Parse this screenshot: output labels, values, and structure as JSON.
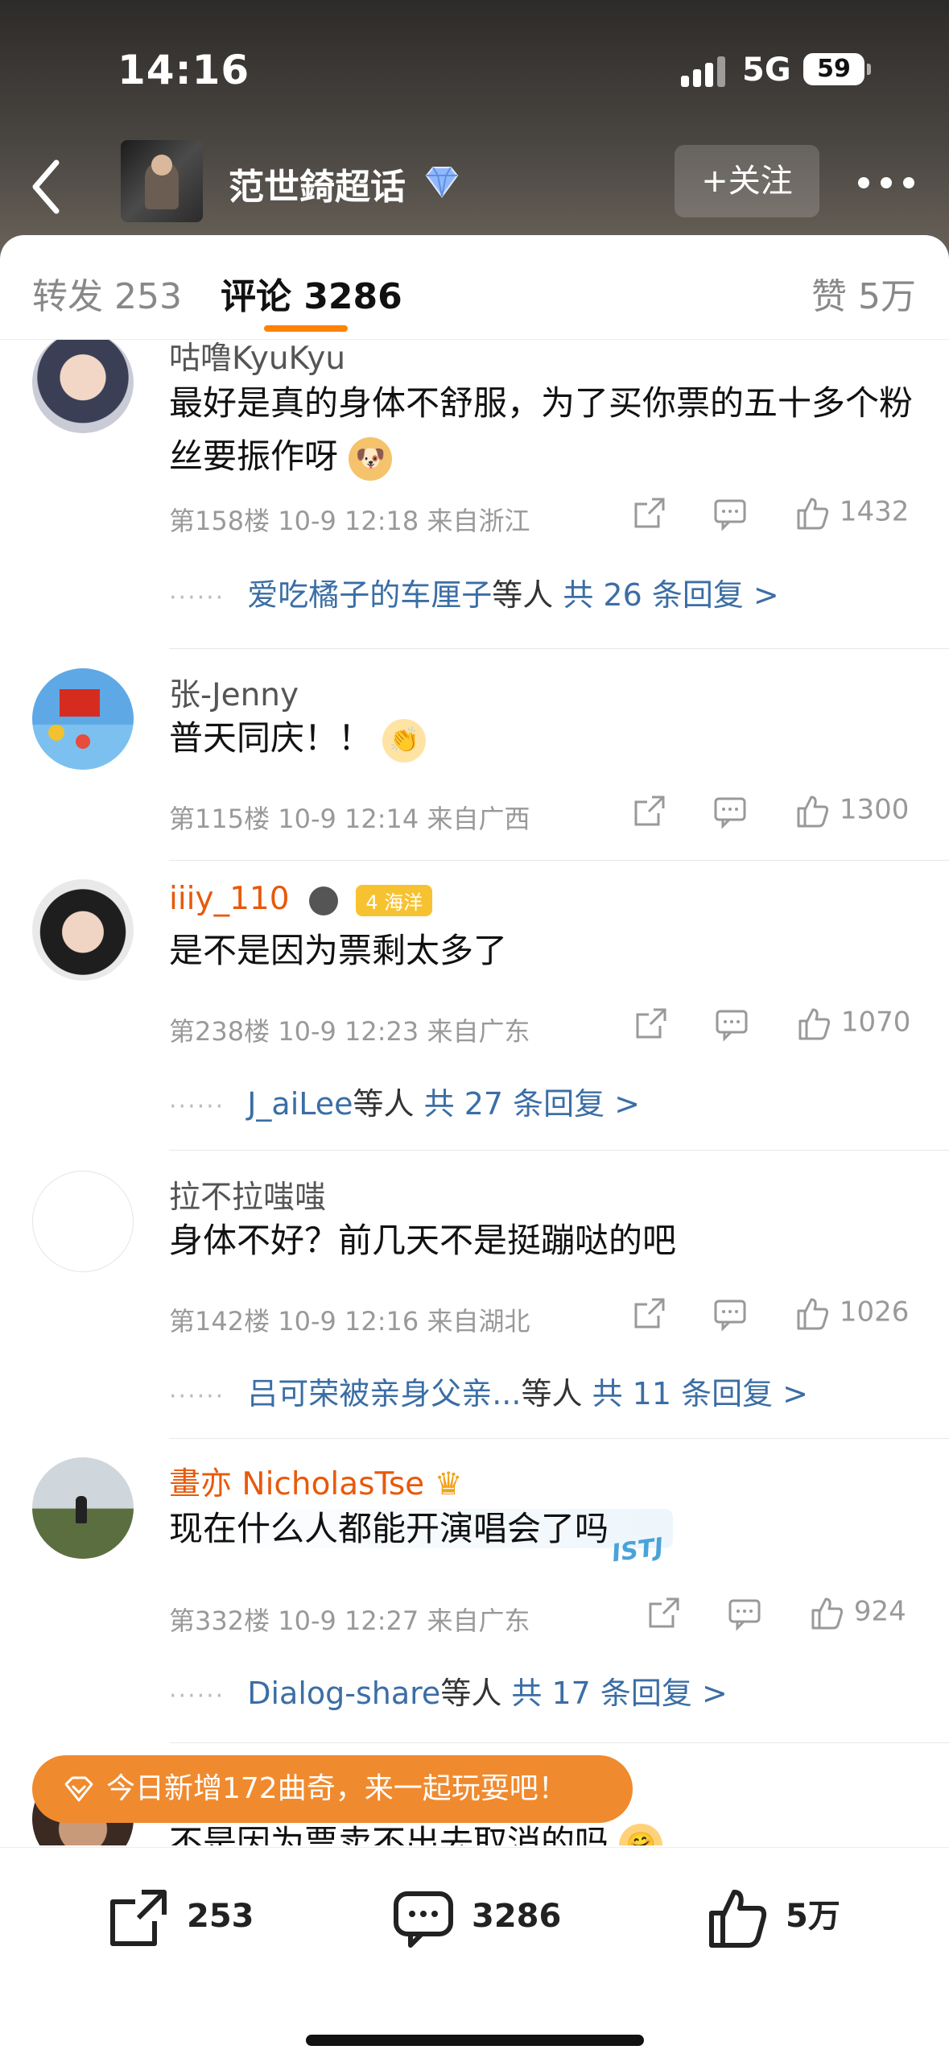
{
  "status_bar": {
    "time": "14:16",
    "network": "5G",
    "battery": "59"
  },
  "header": {
    "title": "范世錡超话",
    "follow_label": "+关注"
  },
  "tabs": {
    "repost": "转发 253",
    "comments": "评论 3286",
    "likes": "赞 5万"
  },
  "comments": [
    {
      "username": "咕噜KyuKyu",
      "text": "最好是真的身体不舒服，为了买你票的五十多个粉丝要振作呀",
      "meta": "第158楼  10-9 12:18  来自浙江",
      "likes": "1432",
      "reply_users": "爱吃橘子的车厘子",
      "reply_suffix": "等人",
      "reply_count": "共 26 条回复 >"
    },
    {
      "username": "张-Jenny",
      "text": "普天同庆！！",
      "meta": "第115楼  10-9 12:14  来自广西",
      "likes": "1300"
    },
    {
      "username": "iiiy_110",
      "badge": "4 海洋",
      "text": "是不是因为票剩太多了",
      "meta": "第238楼  10-9 12:23  来自广东",
      "likes": "1070",
      "reply_users": "J_aiLee",
      "reply_suffix": "等人",
      "reply_count": "共 27 条回复 >"
    },
    {
      "username": "拉不拉嗤嗤",
      "text": "身体不好？前几天不是挺蹦哒的吧",
      "meta": "第142楼  10-9 12:16  来自湖北",
      "likes": "1026",
      "reply_users": "吕可荣被亲身父亲...",
      "reply_suffix": "等人",
      "reply_count": "共 11 条回复 >"
    },
    {
      "username": "畫亦 NicholasTse",
      "text": "现在什么人都能开演唱会了吗",
      "sticker": "ISTJ",
      "meta": "第332楼  10-9 12:27  来自广东",
      "likes": "924",
      "reply_users": "Dialog-share",
      "reply_suffix": "等人",
      "reply_count": "共 17 条回复 >"
    },
    {
      "text": "不是因为票卖不出去取消的吗"
    }
  ],
  "toast": {
    "text": "今日新增172曲奇，来一起玩耍吧！"
  },
  "bottom_bar": {
    "repost": "253",
    "comments": "3286",
    "likes": "5万"
  },
  "icons": [
    "back-icon",
    "diamond-icon",
    "more-icon",
    "share-icon",
    "comment-icon",
    "like-icon"
  ],
  "colors": {
    "accent": "#ff8200",
    "link": "#3b6ea5",
    "toast": "#f08a2e",
    "vip_name": "#e8590b"
  }
}
